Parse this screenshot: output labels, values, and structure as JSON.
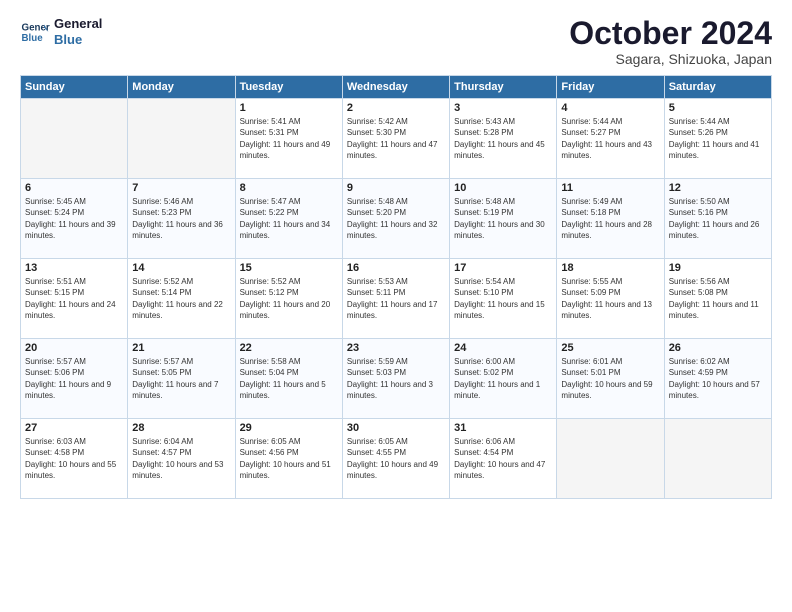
{
  "header": {
    "logo_line1": "General",
    "logo_line2": "Blue",
    "title": "October 2024",
    "location": "Sagara, Shizuoka, Japan"
  },
  "weekdays": [
    "Sunday",
    "Monday",
    "Tuesday",
    "Wednesday",
    "Thursday",
    "Friday",
    "Saturday"
  ],
  "weeks": [
    [
      {
        "day": "",
        "empty": true
      },
      {
        "day": "",
        "empty": true
      },
      {
        "day": "1",
        "sunrise": "5:41 AM",
        "sunset": "5:31 PM",
        "daylight": "11 hours and 49 minutes."
      },
      {
        "day": "2",
        "sunrise": "5:42 AM",
        "sunset": "5:30 PM",
        "daylight": "11 hours and 47 minutes."
      },
      {
        "day": "3",
        "sunrise": "5:43 AM",
        "sunset": "5:28 PM",
        "daylight": "11 hours and 45 minutes."
      },
      {
        "day": "4",
        "sunrise": "5:44 AM",
        "sunset": "5:27 PM",
        "daylight": "11 hours and 43 minutes."
      },
      {
        "day": "5",
        "sunrise": "5:44 AM",
        "sunset": "5:26 PM",
        "daylight": "11 hours and 41 minutes."
      }
    ],
    [
      {
        "day": "6",
        "sunrise": "5:45 AM",
        "sunset": "5:24 PM",
        "daylight": "11 hours and 39 minutes."
      },
      {
        "day": "7",
        "sunrise": "5:46 AM",
        "sunset": "5:23 PM",
        "daylight": "11 hours and 36 minutes."
      },
      {
        "day": "8",
        "sunrise": "5:47 AM",
        "sunset": "5:22 PM",
        "daylight": "11 hours and 34 minutes."
      },
      {
        "day": "9",
        "sunrise": "5:48 AM",
        "sunset": "5:20 PM",
        "daylight": "11 hours and 32 minutes."
      },
      {
        "day": "10",
        "sunrise": "5:48 AM",
        "sunset": "5:19 PM",
        "daylight": "11 hours and 30 minutes."
      },
      {
        "day": "11",
        "sunrise": "5:49 AM",
        "sunset": "5:18 PM",
        "daylight": "11 hours and 28 minutes."
      },
      {
        "day": "12",
        "sunrise": "5:50 AM",
        "sunset": "5:16 PM",
        "daylight": "11 hours and 26 minutes."
      }
    ],
    [
      {
        "day": "13",
        "sunrise": "5:51 AM",
        "sunset": "5:15 PM",
        "daylight": "11 hours and 24 minutes."
      },
      {
        "day": "14",
        "sunrise": "5:52 AM",
        "sunset": "5:14 PM",
        "daylight": "11 hours and 22 minutes."
      },
      {
        "day": "15",
        "sunrise": "5:52 AM",
        "sunset": "5:12 PM",
        "daylight": "11 hours and 20 minutes."
      },
      {
        "day": "16",
        "sunrise": "5:53 AM",
        "sunset": "5:11 PM",
        "daylight": "11 hours and 17 minutes."
      },
      {
        "day": "17",
        "sunrise": "5:54 AM",
        "sunset": "5:10 PM",
        "daylight": "11 hours and 15 minutes."
      },
      {
        "day": "18",
        "sunrise": "5:55 AM",
        "sunset": "5:09 PM",
        "daylight": "11 hours and 13 minutes."
      },
      {
        "day": "19",
        "sunrise": "5:56 AM",
        "sunset": "5:08 PM",
        "daylight": "11 hours and 11 minutes."
      }
    ],
    [
      {
        "day": "20",
        "sunrise": "5:57 AM",
        "sunset": "5:06 PM",
        "daylight": "11 hours and 9 minutes."
      },
      {
        "day": "21",
        "sunrise": "5:57 AM",
        "sunset": "5:05 PM",
        "daylight": "11 hours and 7 minutes."
      },
      {
        "day": "22",
        "sunrise": "5:58 AM",
        "sunset": "5:04 PM",
        "daylight": "11 hours and 5 minutes."
      },
      {
        "day": "23",
        "sunrise": "5:59 AM",
        "sunset": "5:03 PM",
        "daylight": "11 hours and 3 minutes."
      },
      {
        "day": "24",
        "sunrise": "6:00 AM",
        "sunset": "5:02 PM",
        "daylight": "11 hours and 1 minute."
      },
      {
        "day": "25",
        "sunrise": "6:01 AM",
        "sunset": "5:01 PM",
        "daylight": "10 hours and 59 minutes."
      },
      {
        "day": "26",
        "sunrise": "6:02 AM",
        "sunset": "4:59 PM",
        "daylight": "10 hours and 57 minutes."
      }
    ],
    [
      {
        "day": "27",
        "sunrise": "6:03 AM",
        "sunset": "4:58 PM",
        "daylight": "10 hours and 55 minutes."
      },
      {
        "day": "28",
        "sunrise": "6:04 AM",
        "sunset": "4:57 PM",
        "daylight": "10 hours and 53 minutes."
      },
      {
        "day": "29",
        "sunrise": "6:05 AM",
        "sunset": "4:56 PM",
        "daylight": "10 hours and 51 minutes."
      },
      {
        "day": "30",
        "sunrise": "6:05 AM",
        "sunset": "4:55 PM",
        "daylight": "10 hours and 49 minutes."
      },
      {
        "day": "31",
        "sunrise": "6:06 AM",
        "sunset": "4:54 PM",
        "daylight": "10 hours and 47 minutes."
      },
      {
        "day": "",
        "empty": true
      },
      {
        "day": "",
        "empty": true
      }
    ]
  ]
}
